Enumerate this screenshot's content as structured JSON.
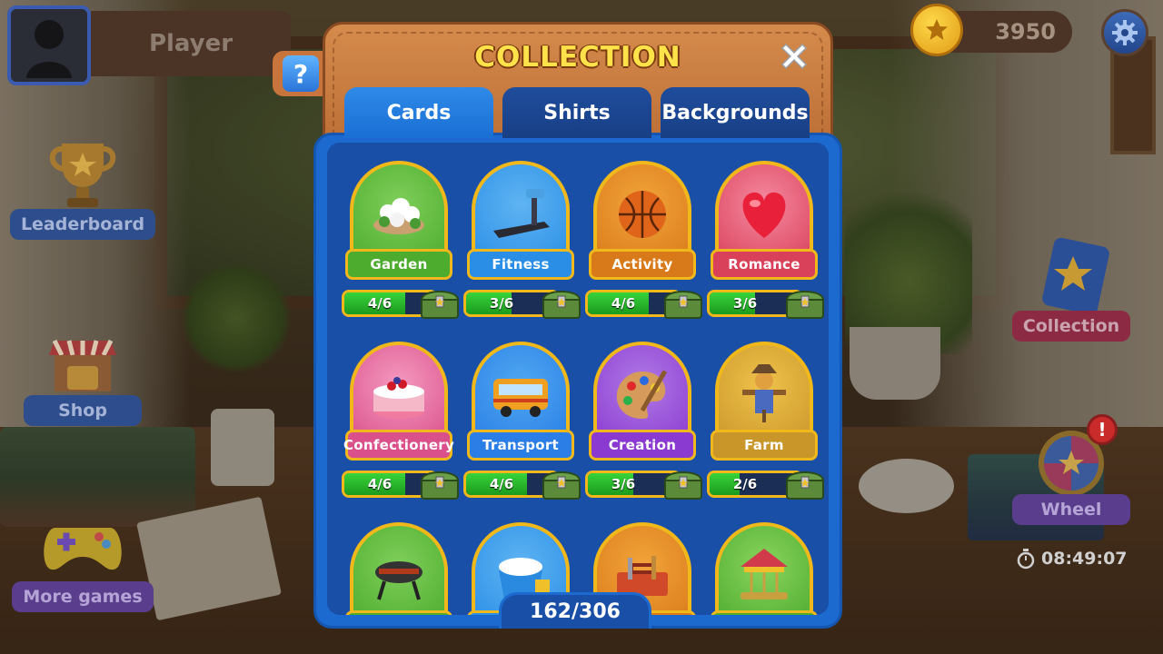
{
  "hud": {
    "player_name": "Player",
    "coins": "3950",
    "help_glyph": "?"
  },
  "side_left": [
    {
      "label": "Leaderboard",
      "icon": "trophy-icon"
    },
    {
      "label": "Shop",
      "icon": "shop-icon"
    },
    {
      "label": "More games",
      "icon": "gamepad-icon"
    }
  ],
  "side_right": [
    {
      "label": "Collection",
      "icon": "album-icon"
    },
    {
      "label": "Wheel",
      "icon": "wheel-icon"
    }
  ],
  "timer": "08:49:07",
  "alert_glyph": "!",
  "panel": {
    "title": "COLLECTION",
    "tabs": [
      {
        "label": "Cards",
        "active": true
      },
      {
        "label": "Shirts",
        "active": false
      },
      {
        "label": "Backgrounds",
        "active": false
      }
    ],
    "total": "162/306"
  },
  "cards": [
    {
      "name": "Garden",
      "progress": "4/6",
      "fraction": 0.667,
      "label_color": "#4dab2e",
      "bg": "#7fcf5a",
      "icon": "flower-icon"
    },
    {
      "name": "Fitness",
      "progress": "3/6",
      "fraction": 0.5,
      "label_color": "#2a8ee6",
      "bg": "#5fb4f2",
      "icon": "treadmill-icon"
    },
    {
      "name": "Activity",
      "progress": "4/6",
      "fraction": 0.667,
      "label_color": "#d97a1a",
      "bg": "#f2a43a",
      "icon": "basketball-icon"
    },
    {
      "name": "Romance",
      "progress": "3/6",
      "fraction": 0.5,
      "label_color": "#d9405a",
      "bg": "#f58aa0",
      "icon": "heart-icon"
    },
    {
      "name": "Confectionery",
      "progress": "4/6",
      "fraction": 0.667,
      "label_color": "#d9508a",
      "bg": "#f59ac0",
      "icon": "cake-icon"
    },
    {
      "name": "Transport",
      "progress": "4/6",
      "fraction": 0.667,
      "label_color": "#2a7ee6",
      "bg": "#4fa8f0",
      "icon": "bus-icon"
    },
    {
      "name": "Creation",
      "progress": "3/6",
      "fraction": 0.5,
      "label_color": "#8a3ad0",
      "bg": "#b07ae6",
      "icon": "palette-icon"
    },
    {
      "name": "Farm",
      "progress": "2/6",
      "fraction": 0.333,
      "label_color": "#c9962a",
      "bg": "#f0c24a",
      "icon": "scarecrow-icon"
    },
    {
      "name": "",
      "progress": "",
      "fraction": 0,
      "label_color": "#4dab2e",
      "bg": "#7fcf5a",
      "icon": "grill-icon"
    },
    {
      "name": "",
      "progress": "",
      "fraction": 0,
      "label_color": "#2a8ee6",
      "bg": "#5fb4f2",
      "icon": "bucket-icon"
    },
    {
      "name": "",
      "progress": "",
      "fraction": 0,
      "label_color": "#d97a1a",
      "bg": "#f2a43a",
      "icon": "toolbox-icon"
    },
    {
      "name": "",
      "progress": "",
      "fraction": 0,
      "label_color": "#4dab2e",
      "bg": "#8ad45e",
      "icon": "carousel-icon"
    }
  ]
}
